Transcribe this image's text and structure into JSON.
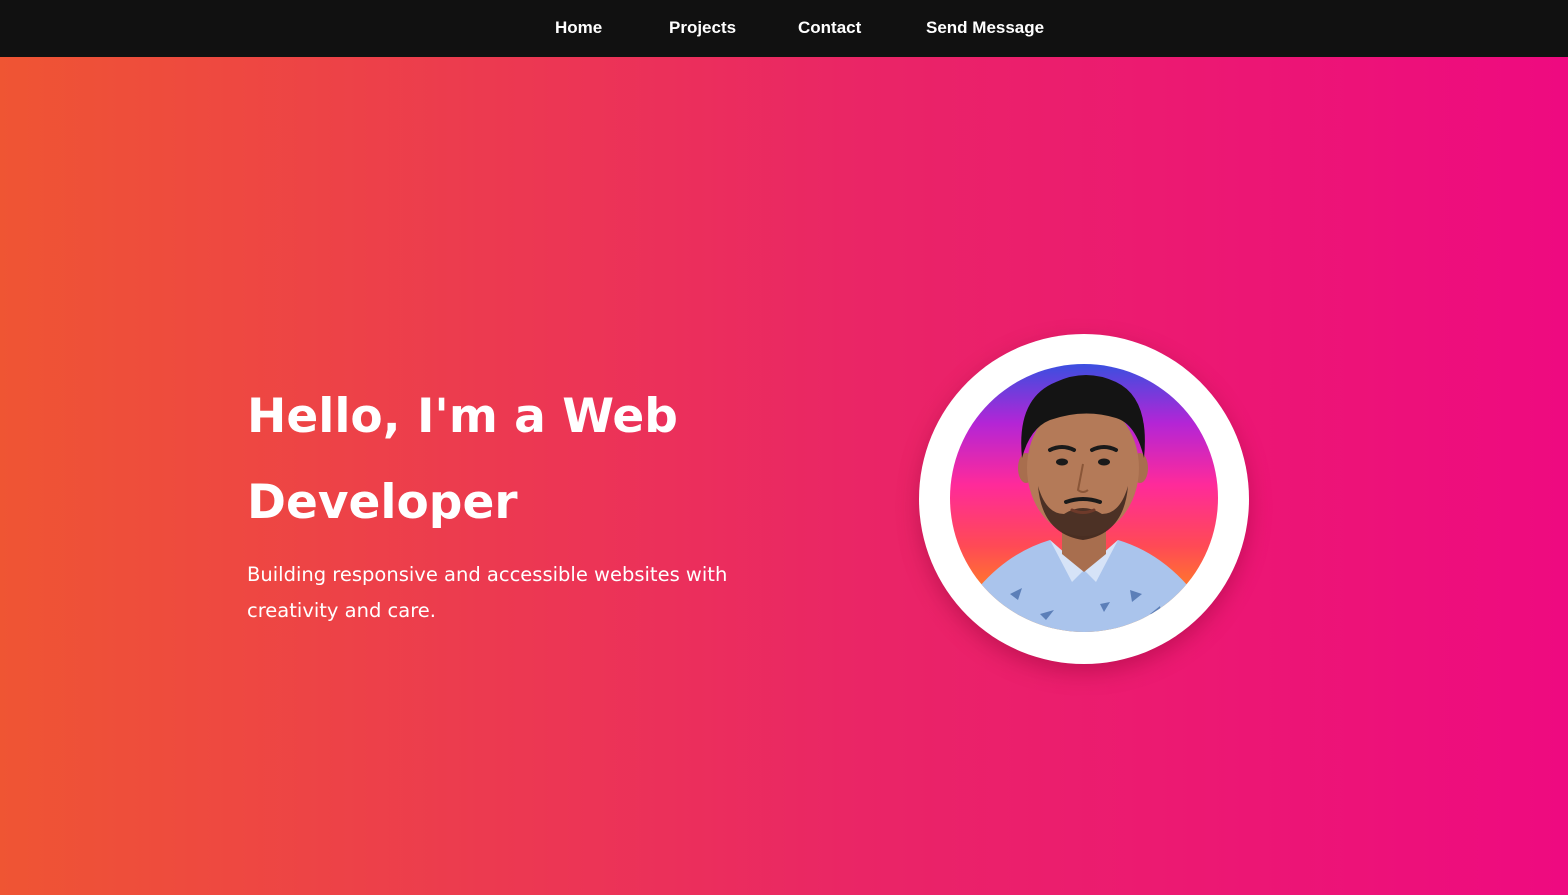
{
  "nav": {
    "items": [
      {
        "label": "Home"
      },
      {
        "label": "Projects"
      },
      {
        "label": "Contact"
      },
      {
        "label": "Send Message"
      }
    ]
  },
  "hero": {
    "title": "Hello, I'm a Web Developer",
    "subtitle": "Building responsive and accessible websites with creativity and care.",
    "avatar_icon": "profile-photo"
  },
  "colors": {
    "nav_background": "#111111",
    "gradient_start": "#ef5533",
    "gradient_end": "#ee0a80",
    "text": "#ffffff"
  }
}
